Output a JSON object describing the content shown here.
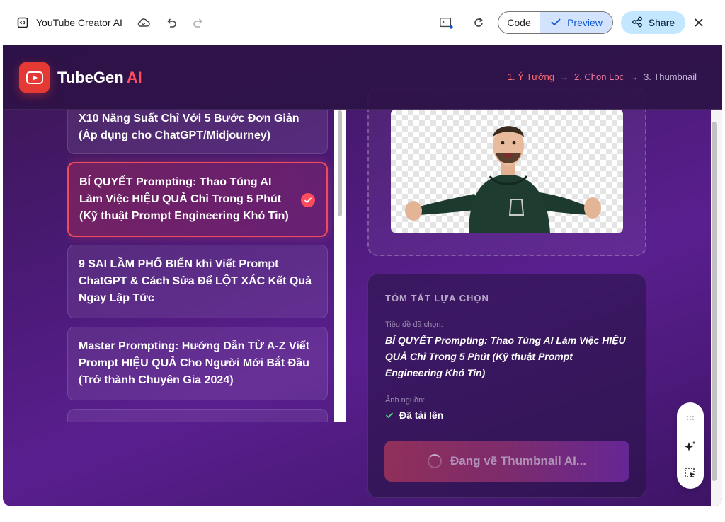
{
  "window": {
    "title": "YouTube Creator AI",
    "code_label": "Code",
    "preview_label": "Preview",
    "share_label": "Share"
  },
  "app": {
    "brand_name": "TubeGen",
    "brand_suffix": "AI",
    "steps": [
      {
        "label": "1. Ý Tưởng"
      },
      {
        "label": "2. Chọn Lọc"
      },
      {
        "label": "3. Thumbnail"
      }
    ]
  },
  "titles": [
    {
      "text": "X10 Năng Suất Chỉ Với 5 Bước Đơn Giản (Áp dụng cho ChatGPT/Midjourney)",
      "selected": false
    },
    {
      "text": "BÍ QUYẾT Prompting: Thao Túng AI Làm Việc HIỆU QUẢ Chỉ Trong 5 Phút (Kỹ thuật Prompt Engineering Khó Tin)",
      "selected": true
    },
    {
      "text": "9 SAI LẦM PHỔ BIẾN khi Viết Prompt ChatGPT & Cách Sửa Để LỘT XÁC Kết Quả Ngay Lập Tức",
      "selected": false
    },
    {
      "text": "Master Prompting: Hướng Dẫn TỪ A-Z Viết Prompt HIỆU QUẢ Cho Người Mới Bắt Đầu (Trở thành Chuyên Gia 2024)",
      "selected": false
    },
    {
      "text": "",
      "selected": false
    }
  ],
  "summary": {
    "heading": "TÓM TẮT LỰA CHỌN",
    "title_label": "Tiêu đề đã chọn:",
    "title_value": "BÍ QUYẾT Prompting: Thao Túng AI Làm Việc HIỆU QUẢ Chỉ Trong 5 Phút (Kỹ thuật Prompt Engineering Khó Tin)",
    "image_label": "Ảnh nguồn:",
    "image_status": "Đã tải lên",
    "generate_label": "Đang vẽ Thumbnail AI..."
  },
  "colors": {
    "accent": "#ff4d5e",
    "logo_red": "#e53935",
    "bg_purple": "#4b1a77"
  },
  "icons": [
    "code-icon",
    "cloud-icon",
    "undo-icon",
    "redo-icon",
    "terminal-icon",
    "refresh-icon",
    "check-icon",
    "share-icon",
    "close-icon",
    "youtube-play-icon",
    "drag-handle-icon",
    "sparkle-icon",
    "select-icon"
  ]
}
